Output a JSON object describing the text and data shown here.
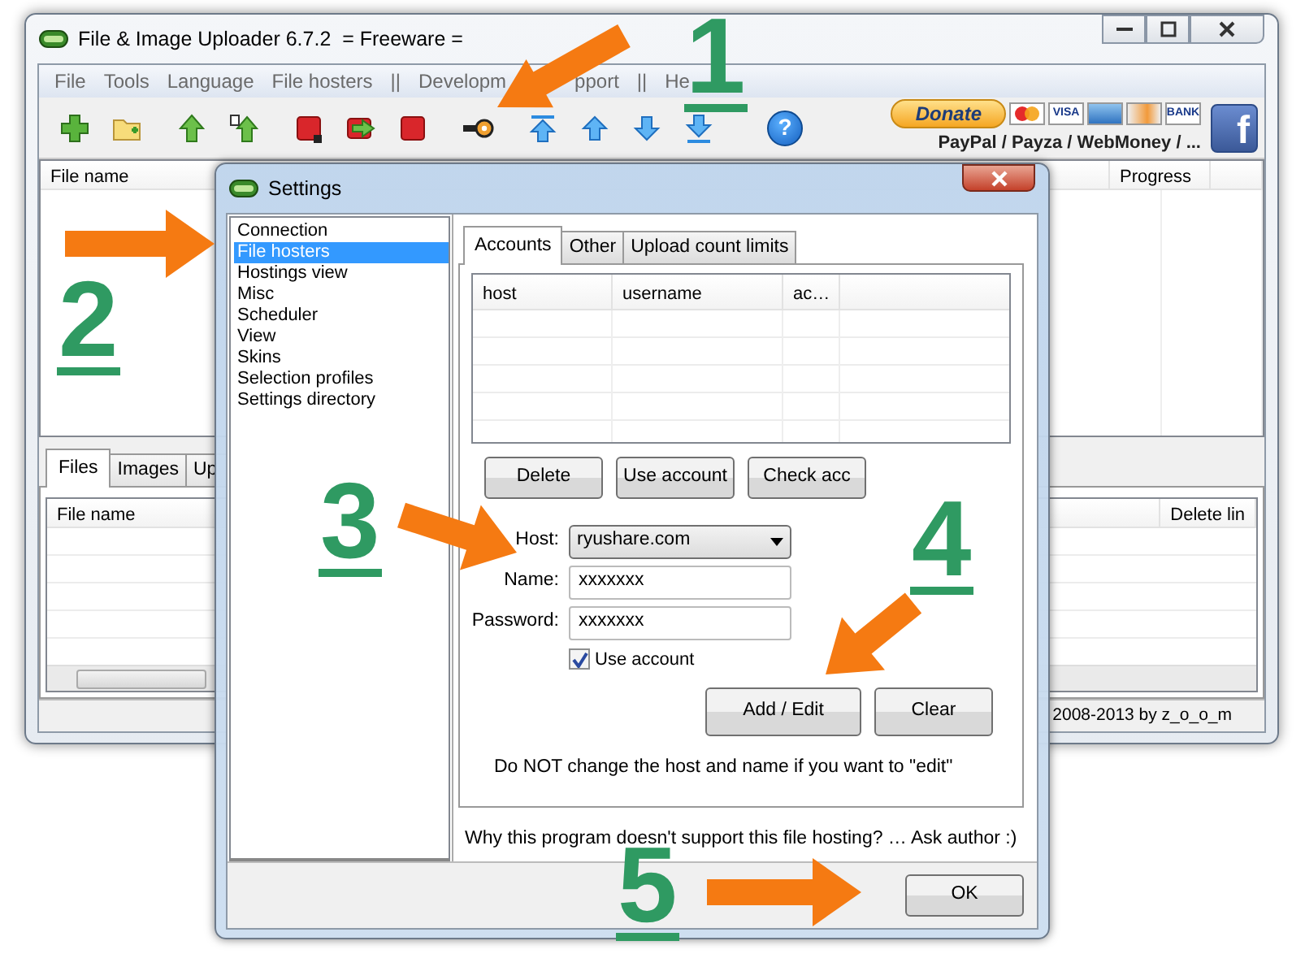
{
  "main_window": {
    "title": "File & Image Uploader 6.7.2  = Freeware =",
    "menu": [
      "File",
      "Tools",
      "Language",
      "File hosters",
      "||",
      "Developm",
      "pport",
      "||",
      "He"
    ],
    "toolbar": [
      {
        "kind": "add"
      },
      {
        "kind": "folder"
      },
      {
        "kind": "upload"
      },
      {
        "kind": "upload-all"
      },
      {
        "kind": "red"
      },
      {
        "kind": "move"
      },
      {
        "kind": "stop"
      },
      {
        "kind": "key"
      },
      {
        "kind": "top"
      },
      {
        "kind": "up"
      },
      {
        "kind": "down"
      },
      {
        "kind": "bottom"
      },
      {
        "kind": "help",
        "glyph": "?"
      }
    ],
    "donate": {
      "label": "Donate",
      "cards": [
        {
          "kind": "mastercard"
        },
        {
          "kind": "text",
          "label": "VISA"
        },
        {
          "kind": "amex"
        },
        {
          "kind": "discover"
        },
        {
          "kind": "text",
          "label": "BANK"
        }
      ],
      "methods": "PayPal / Payza / WebMoney / ...",
      "social_glyph": "f"
    },
    "file_list": {
      "columns": [
        "File name",
        "Progress"
      ]
    },
    "lower_tabs": [
      {
        "label": "Files",
        "selected": true
      },
      {
        "label": "Images",
        "selected": false
      },
      {
        "label": "Up",
        "selected": false
      }
    ],
    "lower_list": {
      "columns": [
        "File name",
        "Delete lin"
      ]
    },
    "status": "2008-2013 by z_o_o_m"
  },
  "settings_dialog": {
    "title": "Settings",
    "categories": [
      {
        "label": "Connection",
        "selected": false
      },
      {
        "label": "File hosters",
        "selected": true
      },
      {
        "label": "Hostings view",
        "selected": false
      },
      {
        "label": "Misc",
        "selected": false
      },
      {
        "label": "Scheduler",
        "selected": false
      },
      {
        "label": "View",
        "selected": false
      },
      {
        "label": "Skins",
        "selected": false
      },
      {
        "label": "Selection profiles",
        "selected": false
      },
      {
        "label": "Settings directory",
        "selected": false
      }
    ],
    "tabs": [
      {
        "label": "Accounts",
        "selected": true
      },
      {
        "label": "Other",
        "selected": false
      },
      {
        "label": "Upload count limits",
        "selected": false
      }
    ],
    "accounts_table": {
      "columns": [
        "host",
        "username",
        "ac…"
      ]
    },
    "buttons": [
      "Delete",
      "Use account",
      "Check acc"
    ],
    "host": {
      "label": "Host:",
      "value": "ryushare.com"
    },
    "name": {
      "label": "Name:",
      "value": "xxxxxxx"
    },
    "password": {
      "label": "Password:",
      "value": "xxxxxxx"
    },
    "use_account": {
      "label": "Use account",
      "checked": true
    },
    "action_buttons": [
      "Add / Edit",
      "Clear"
    ],
    "note": "Do NOT change the host and name if you want to \"edit\"",
    "support_text": "Why this program doesn't support this file hosting? … Ask author :)",
    "ok_button": "OK"
  },
  "annotations": [
    {
      "label": "1"
    },
    {
      "label": "2"
    },
    {
      "label": "3"
    },
    {
      "label": "4"
    },
    {
      "label": "5"
    }
  ]
}
